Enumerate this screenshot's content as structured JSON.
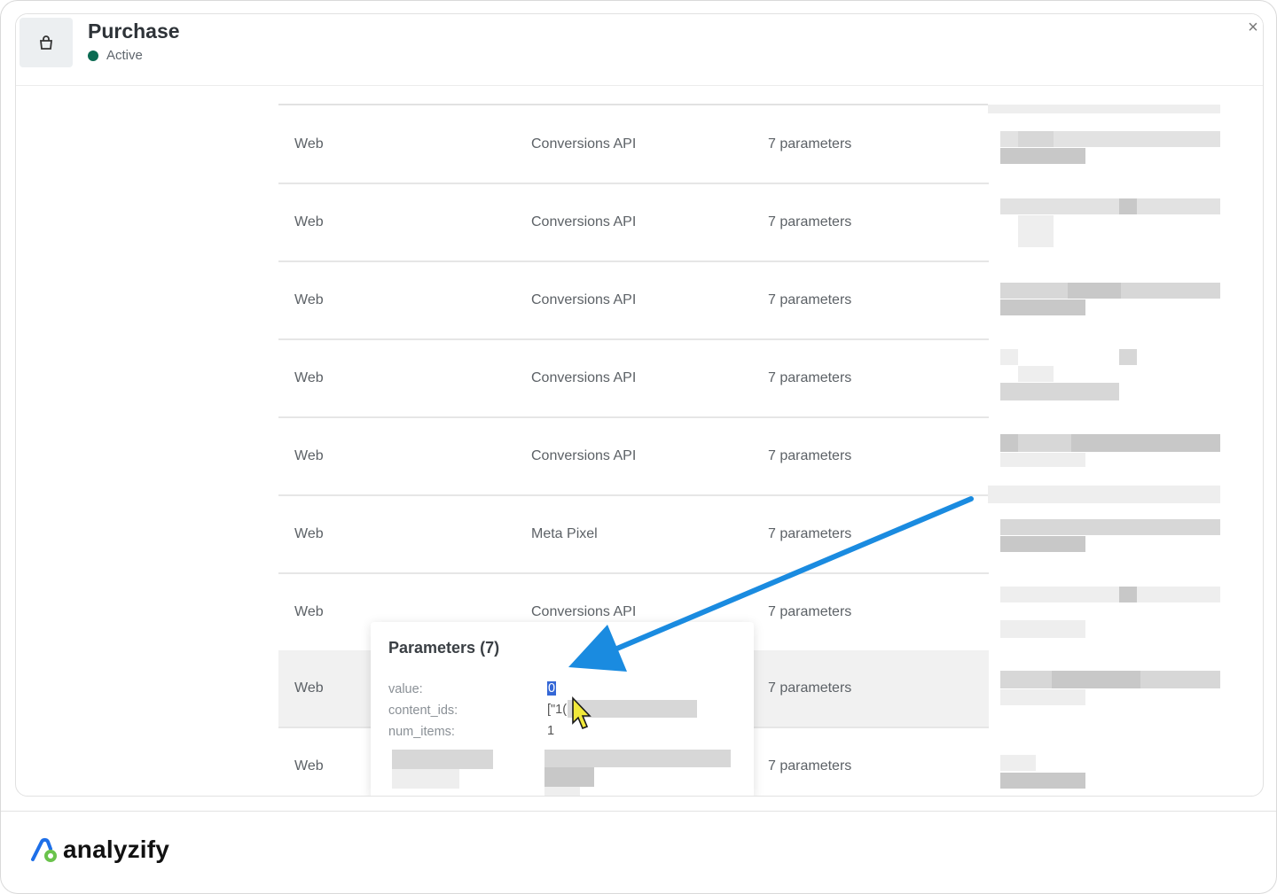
{
  "header": {
    "title": "Purchase",
    "status": "Active",
    "icon": "shopping-bag-icon",
    "close_icon": "×"
  },
  "table": {
    "rows": [
      {
        "source": "Web",
        "method": "Conversions API",
        "params": "7 parameters"
      },
      {
        "source": "Web",
        "method": "Conversions API",
        "params": "7 parameters"
      },
      {
        "source": "Web",
        "method": "Conversions API",
        "params": "7 parameters"
      },
      {
        "source": "Web",
        "method": "Conversions API",
        "params": "7 parameters"
      },
      {
        "source": "Web",
        "method": "Conversions API",
        "params": "7 parameters"
      },
      {
        "source": "Web",
        "method": "Meta Pixel",
        "params": "7 parameters"
      },
      {
        "source": "Web",
        "method": "Conversions API",
        "params": "7 parameters"
      },
      {
        "source": "Web",
        "method": "",
        "params": "7 parameters"
      },
      {
        "source": "Web",
        "method": "",
        "params": "7 parameters"
      }
    ]
  },
  "popup": {
    "title": "Parameters (7)",
    "params": [
      {
        "key": "value:",
        "value": "0"
      },
      {
        "key": "content_ids:",
        "value": "[\"1("
      },
      {
        "key": "num_items:",
        "value": "1"
      }
    ]
  },
  "annotation": {
    "arrow_color": "#1a8be0"
  },
  "brand": {
    "name": "analyzify",
    "color_blue": "#1e6fe8",
    "color_green": "#6ac34c"
  }
}
